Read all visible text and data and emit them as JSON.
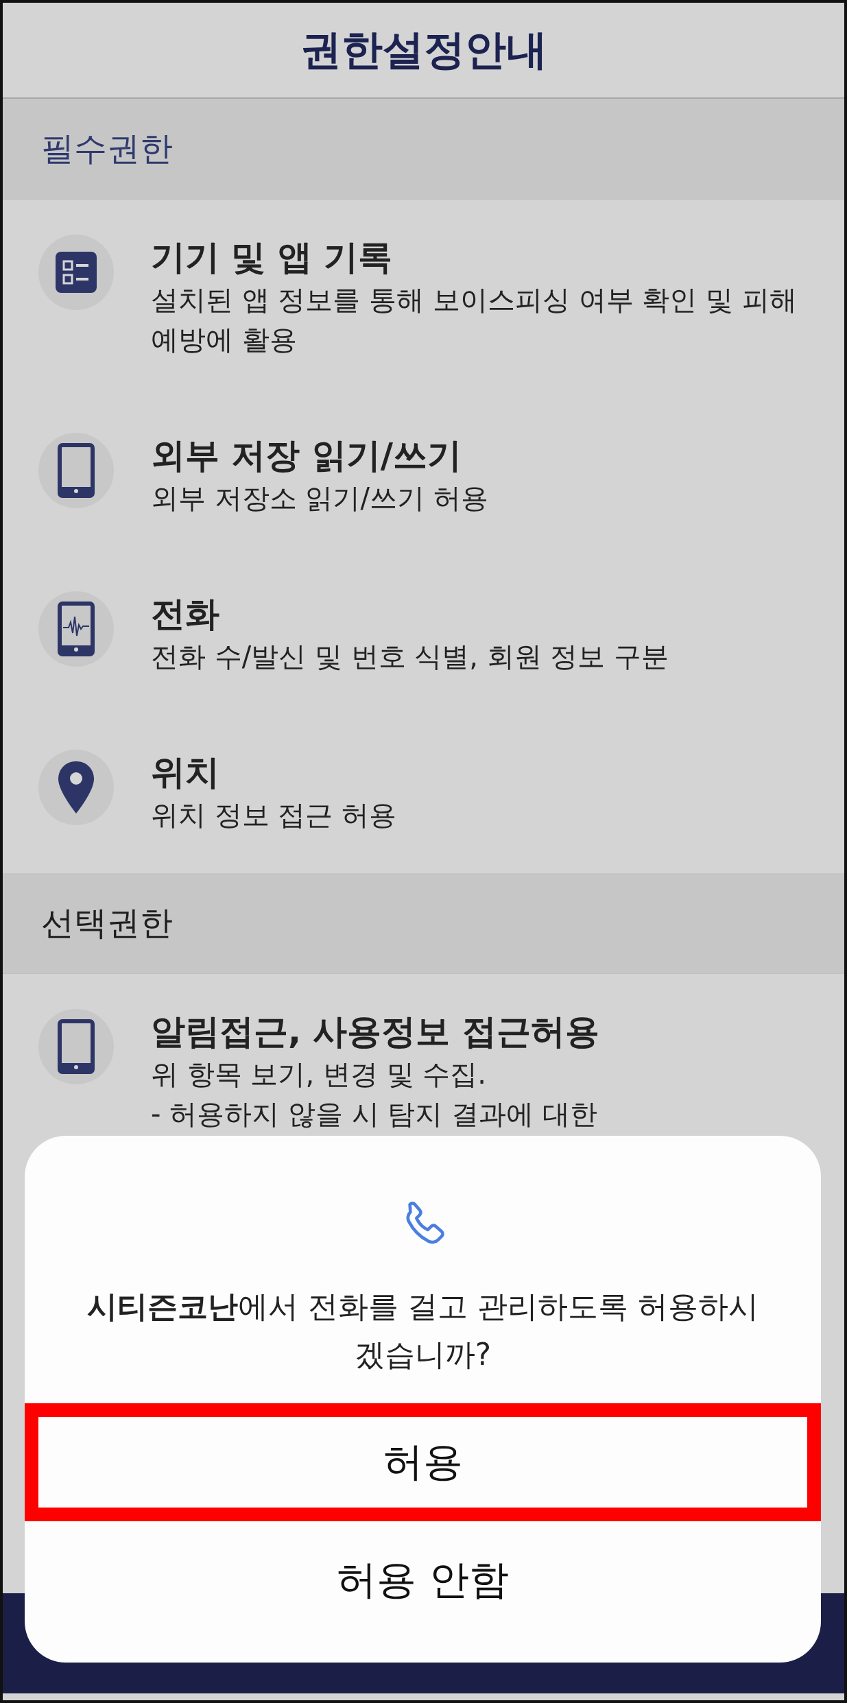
{
  "header": {
    "title": "권한설정안내"
  },
  "sections": [
    {
      "title": "필수권한",
      "color": "#2f3a6e",
      "items": [
        {
          "kind": "list",
          "title": "기기 및 앱 기록",
          "description": [
            "설치된 앱 정보를 통해 보이스피싱 여부 확인 및 피해예방에 활용"
          ]
        },
        {
          "kind": "tablet",
          "title": "외부 저장 읽기/쓰기",
          "description": [
            "외부 저장소 읽기/쓰기 허용"
          ]
        },
        {
          "kind": "tablet-wave",
          "title": "전화",
          "description": [
            "전화 수/발신 및 번호 식별, 회원 정보 구분"
          ]
        },
        {
          "kind": "location",
          "title": "위치",
          "description": [
            "위치 정보 접근 허용"
          ]
        }
      ]
    },
    {
      "title": "선택권한",
      "color": "#1e1e1e",
      "items": [
        {
          "kind": "tablet",
          "title": "알림접근, 사용정보 접근허용",
          "description": [
            "위 항목 보기, 변경 및 수집.",
            "- 허용하지 않을 시 탐지 결과에 대한"
          ]
        }
      ]
    }
  ],
  "dialog": {
    "message": "**시티즌코난**에서 전화를 걸고 관리하도록 허용하시겠습니까?",
    "buttons": [
      {
        "label": "허용",
        "highlighted": true
      },
      {
        "label": "허용 안함",
        "highlighted": false
      }
    ]
  }
}
